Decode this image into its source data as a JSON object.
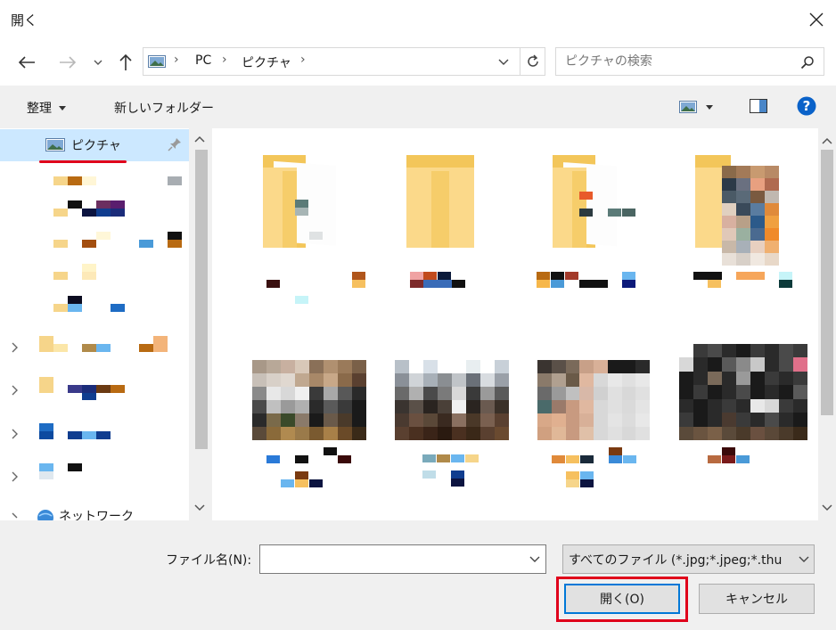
{
  "window": {
    "title": "開く"
  },
  "address": {
    "segments": [
      "PC",
      "ピクチャ"
    ]
  },
  "search": {
    "placeholder": "ピクチャの検索"
  },
  "toolbar": {
    "organize": "整理",
    "new_folder": "新しいフォルダー"
  },
  "nav": {
    "selected": "ピクチャ",
    "network": "ネットワーク"
  },
  "bottom": {
    "filename_label": "ファイル名(N):",
    "filename_value": "",
    "filetype": "すべてのファイル (*.jpg;*.jpeg;*.thu",
    "open": "開く(O)",
    "cancel": "キャンセル"
  },
  "colors": {
    "selection": "#cce8ff",
    "highlight_box": "#e0001b",
    "accent": "#0078d7",
    "underline": "#e0001b"
  }
}
